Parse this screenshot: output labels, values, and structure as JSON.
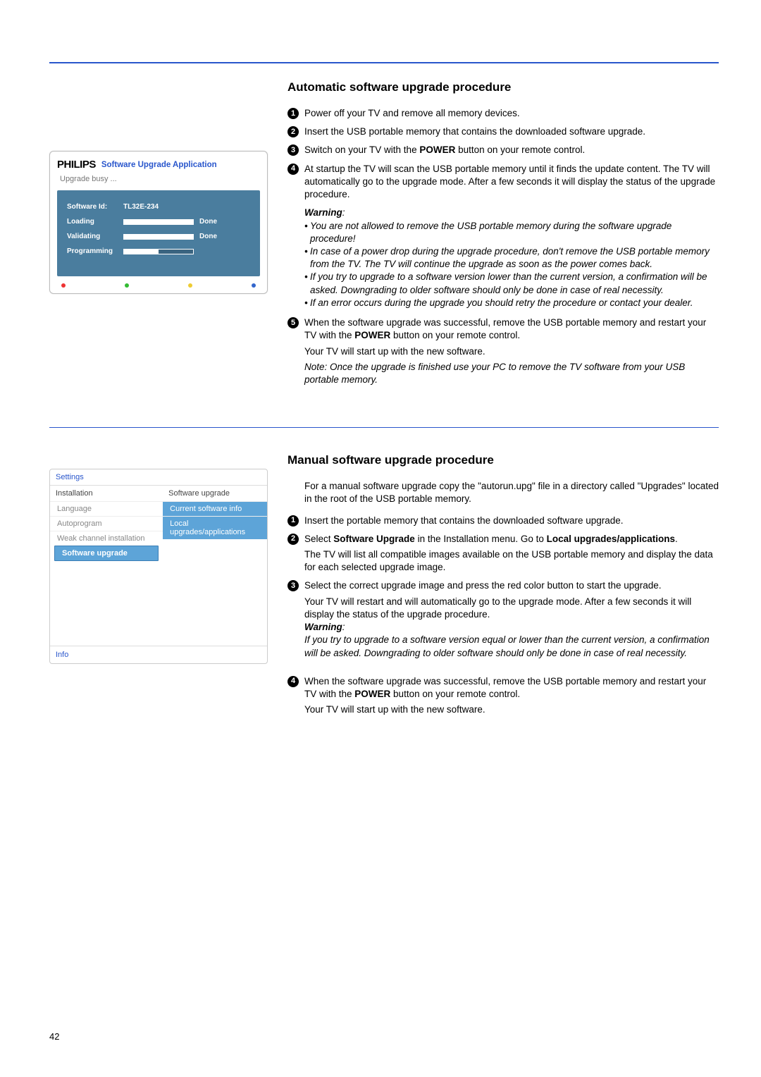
{
  "page_number": "42",
  "section1": {
    "heading": "Automatic software upgrade procedure",
    "steps": {
      "s1": "Power off your TV and remove all memory devices.",
      "s2": "Insert the USB portable memory that contains the downloaded software upgrade.",
      "s3_a": "Switch on your TV with the ",
      "s3_b": "POWER",
      "s3_c": " button on your remote control.",
      "s4": "At startup the TV will scan the USB portable memory until it finds the update content. The TV will automatically go to the upgrade mode. After a few seconds it will display the status of the upgrade procedure.",
      "warning_label": "Warning",
      "w1": "You are not allowed to remove the USB portable memory during the software upgrade procedure!",
      "w2": "In case of a power drop during the upgrade procedure, don't remove the USB portable memory from the TV. The TV will continue the upgrade as soon as the power comes back.",
      "w3": "If you try to upgrade to a software version lower than the current version, a confirmation will be asked. Downgrading to older software should only be done in case of real necessity.",
      "w4": "If an error occurs during the upgrade you should retry the procedure or contact your dealer.",
      "s5_a": "When the software upgrade was successful, remove the USB portable memory and restart your TV with the ",
      "s5_b": "POWER",
      "s5_c": " button on your remote control.",
      "s5_d": "Your TV will start up with the new software.",
      "s5_note": "Note: Once the upgrade is finished use your PC to remove the TV software from your USB portable memory."
    },
    "tv_dialog": {
      "brand": "PHILIPS",
      "title": "Software Upgrade Application",
      "busy": "Upgrade busy ...",
      "rows": {
        "id_label": "Software Id:",
        "id_value": "TL32E-234",
        "loading": "Loading",
        "validating": "Validating",
        "programming": "Programming",
        "done": "Done"
      }
    }
  },
  "section2": {
    "heading": "Manual software upgrade procedure",
    "intro": "For a manual software upgrade copy the \"autorun.upg\" file in a directory called \"Upgrades\" located in the root of the USB portable memory.",
    "s1": "Insert the portable memory that contains the downloaded software upgrade.",
    "s2_a": "Select ",
    "s2_b": "Software Upgrade",
    "s2_c": " in the Installation menu. Go to ",
    "s2_d": "Local upgrades/applications",
    "s2_e": ".",
    "s2_f": "The TV will list all compatible images available on the USB portable memory and display the data for each selected upgrade image.",
    "s3": "Select the correct upgrade image and press the red color button to start the upgrade.",
    "s3b": "Your TV will restart and will automatically go to the upgrade mode. After a few seconds it will display the status of the upgrade procedure.",
    "warning_label": "Warning",
    "w1": "If you try to upgrade to a software version equal or lower than the current version, a confirmation will be asked. Downgrading to older software should only be done in case of real necessity.",
    "s4_a": "When the software upgrade was successful, remove the USB portable memory and restart your TV with the ",
    "s4_b": "POWER",
    "s4_c": " button on your remote control.",
    "s4_d": "Your TV will start up with the new software.",
    "menu": {
      "title": "Settings",
      "left_header": "Installation",
      "right_header": "Software upgrade",
      "left": {
        "i1": "Language",
        "i2": "Autoprogram",
        "i3": "Weak channel installation",
        "i4": "Software upgrade"
      },
      "right": {
        "r1": "Current software info",
        "r2": "Local upgrades/applications"
      },
      "footer": "Info"
    }
  }
}
